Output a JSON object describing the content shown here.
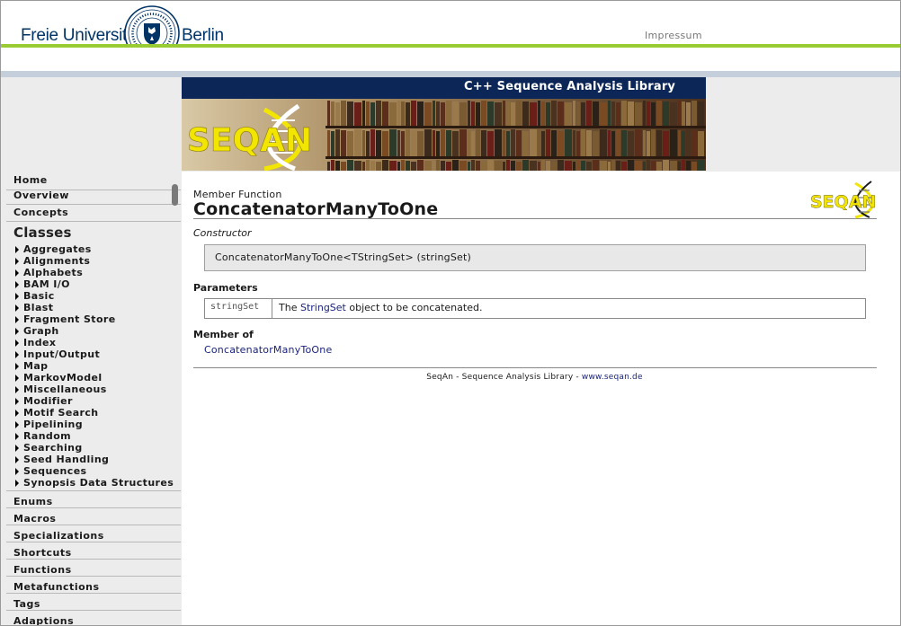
{
  "fu_header": {
    "left_word": "Freie Universität",
    "right_word": "Berlin",
    "impressum": "Impressum"
  },
  "banner": {
    "title": "C++ Sequence Analysis Library",
    "logo_text": "SEQAN"
  },
  "sidebar": {
    "top_items": [
      "Home",
      "Overview",
      "Concepts"
    ],
    "classes_title": "Classes",
    "classes": [
      "Aggregates",
      "Alignments",
      "Alphabets",
      "BAM I/O",
      "Basic",
      "Blast",
      "Fragment Store",
      "Graph",
      "Index",
      "Input/Output",
      "Map",
      "MarkovModel",
      "Miscellaneous",
      "Modifier",
      "Motif Search",
      "Pipelining",
      "Random",
      "Searching",
      "Seed Handling",
      "Sequences",
      "Synopsis Data Structures"
    ],
    "bottom_items": [
      "Enums",
      "Macros",
      "Specializations",
      "Shortcuts",
      "Functions",
      "Metafunctions",
      "Tags",
      "Adaptions"
    ]
  },
  "content": {
    "member_label": "Member Function",
    "title": "ConcatenatorManyToOne",
    "constructor_label": "Constructor",
    "signature": "ConcatenatorManyToOne<TStringSet> (stringSet)",
    "parameters_label": "Parameters",
    "param": {
      "name": "stringSet",
      "desc_prefix": "The ",
      "link": "StringSet",
      "desc_suffix": " object to be concatenated."
    },
    "member_of_label": "Member of",
    "member_of_link": "ConcatenatorManyToOne"
  },
  "footer": {
    "text": "SeqAn - Sequence Analysis Library - ",
    "link": "www.seqan.de"
  },
  "colors": {
    "fu_green": "#99cc33",
    "fu_blue": "#003366",
    "banner_navy": "#0c2757",
    "logo_yellow": "#f2e600",
    "link": "#1a237e"
  }
}
